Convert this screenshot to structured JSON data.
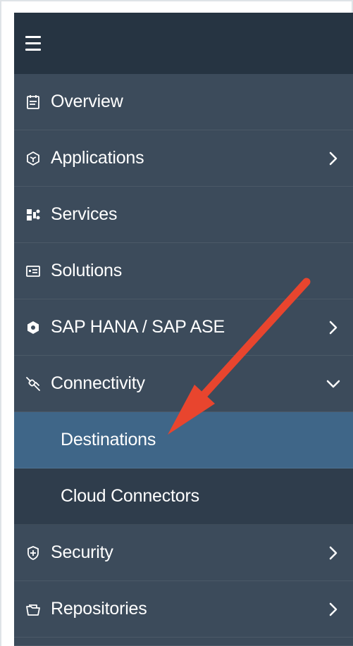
{
  "nav": {
    "items": [
      {
        "label": "Overview",
        "icon": "overview-icon"
      },
      {
        "label": "Applications",
        "icon": "applications-icon",
        "chevron": "chevron-right-icon"
      },
      {
        "label": "Services",
        "icon": "services-icon"
      },
      {
        "label": "Solutions",
        "icon": "solutions-icon"
      },
      {
        "label": "SAP HANA / SAP ASE",
        "icon": "database-icon",
        "chevron": "chevron-right-icon"
      },
      {
        "label": "Connectivity",
        "icon": "connectivity-icon",
        "chevron": "chevron-down-icon"
      },
      {
        "label": "Destinations",
        "active": true
      },
      {
        "label": "Cloud Connectors"
      },
      {
        "label": "Security",
        "icon": "security-icon",
        "chevron": "chevron-right-icon"
      },
      {
        "label": "Repositories",
        "icon": "repositories-icon",
        "chevron": "chevron-right-icon"
      }
    ]
  },
  "colors": {
    "panel": "#3c4b5b",
    "header": "#263442",
    "sub_item": "#2f3d4c",
    "active": "#3f6688",
    "annotation": "#e8452e"
  }
}
